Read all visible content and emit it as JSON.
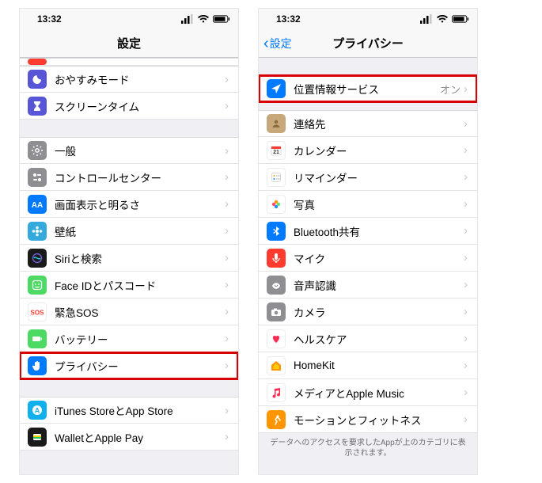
{
  "status": {
    "time": "13:32"
  },
  "left": {
    "title": "設定",
    "sliver_icon_bg": "#ff3b30",
    "group1": [
      {
        "icon": "moon",
        "bg": "#5856d6",
        "label": "おやすみモード"
      },
      {
        "icon": "hourglass",
        "bg": "#5856d6",
        "label": "スクリーンタイム"
      }
    ],
    "group2": [
      {
        "icon": "gear",
        "bg": "#8e8e93",
        "label": "一般"
      },
      {
        "icon": "switches",
        "bg": "#8e8e93",
        "label": "コントロールセンター"
      },
      {
        "icon": "aa",
        "bg": "#007aff",
        "label": "画面表示と明るさ"
      },
      {
        "icon": "flower",
        "bg": "#34aadc",
        "label": "壁紙"
      },
      {
        "icon": "siri",
        "bg": "#1a1a1a",
        "label": "Siriと検索"
      },
      {
        "icon": "face",
        "bg": "#4cd964",
        "label": "Face IDとパスコード"
      },
      {
        "icon": "sos",
        "bg": "#ffffff",
        "fg": "#ff3b30",
        "label": "緊急SOS"
      },
      {
        "icon": "battery",
        "bg": "#4cd964",
        "label": "バッテリー"
      },
      {
        "icon": "hand",
        "bg": "#007aff",
        "label": "プライバシー",
        "highlight": true
      }
    ],
    "group3": [
      {
        "icon": "appstore",
        "bg": "#11b0ed",
        "label": "iTunes StoreとApp Store"
      },
      {
        "icon": "wallet",
        "bg": "#1a1a1a",
        "label": "WalletとApple Pay"
      }
    ]
  },
  "right": {
    "back": "設定",
    "title": "プライバシー",
    "group1": [
      {
        "icon": "location",
        "bg": "#007aff",
        "label": "位置情報サービス",
        "detail": "オン",
        "highlight": true
      }
    ],
    "group2": [
      {
        "icon": "contacts",
        "bg": "#c7a87a",
        "label": "連絡先"
      },
      {
        "icon": "calendar",
        "bg": "#ffffff",
        "label": "カレンダー"
      },
      {
        "icon": "reminders",
        "bg": "#ffffff",
        "label": "リマインダー"
      },
      {
        "icon": "photos",
        "bg": "#ffffff",
        "label": "写真"
      },
      {
        "icon": "bluetooth",
        "bg": "#007aff",
        "label": "Bluetooth共有"
      },
      {
        "icon": "mic",
        "bg": "#ff3b30",
        "label": "マイク"
      },
      {
        "icon": "speech",
        "bg": "#8e8e93",
        "label": "音声認識"
      },
      {
        "icon": "camera",
        "bg": "#8e8e93",
        "label": "カメラ"
      },
      {
        "icon": "health",
        "bg": "#ffffff",
        "label": "ヘルスケア"
      },
      {
        "icon": "homekit",
        "bg": "#ffffff",
        "label": "HomeKit"
      },
      {
        "icon": "music",
        "bg": "#ffffff",
        "label": "メディアとApple Music"
      },
      {
        "icon": "motion",
        "bg": "#ff9500",
        "label": "モーションとフィットネス"
      }
    ],
    "footer": "データへのアクセスを要求したAppが上のカテゴリに表示されます。"
  }
}
